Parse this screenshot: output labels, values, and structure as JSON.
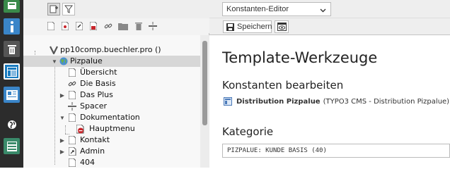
{
  "module_menu": {
    "items": [
      {
        "name": "page-module",
        "active": false
      },
      {
        "name": "info-module",
        "active": false
      },
      {
        "name": "recycler-module",
        "active": false
      },
      {
        "name": "template-module",
        "active": true
      },
      {
        "name": "view-module",
        "active": false
      },
      {
        "name": "globe-module",
        "active": false
      },
      {
        "name": "list-module",
        "active": false
      }
    ]
  },
  "tree": {
    "root_label": "pp10comp.buechler.pro ()",
    "nodes": [
      {
        "label": "Pizpalue",
        "selected": true
      },
      {
        "label": "Übersicht"
      },
      {
        "label": "Die Basis"
      },
      {
        "label": "Das Plus"
      },
      {
        "label": "Spacer"
      },
      {
        "label": "Dokumentation"
      },
      {
        "label": "Hauptmenu"
      },
      {
        "label": "Kontakt"
      },
      {
        "label": "Admin"
      },
      {
        "label": "404"
      }
    ]
  },
  "toolbar": {
    "module_select_value": "Konstanten-Editor",
    "save_label": "Speichern"
  },
  "main": {
    "title": "Template-Werkzeuge",
    "section_title": "Konstanten bearbeiten",
    "distribution_name": "Distribution Pizpalue",
    "distribution_detail": "(TYPO3 CMS - Distribution Pizpalue)",
    "category_title": "Kategorie",
    "category_value": "PIZPALUE: KUNDE BASIS (40)"
  },
  "colors": {
    "modbar_bg": "#2c2c2c",
    "accent_blue": "#1a7bbf",
    "page_icon_red": "#c7252b"
  }
}
